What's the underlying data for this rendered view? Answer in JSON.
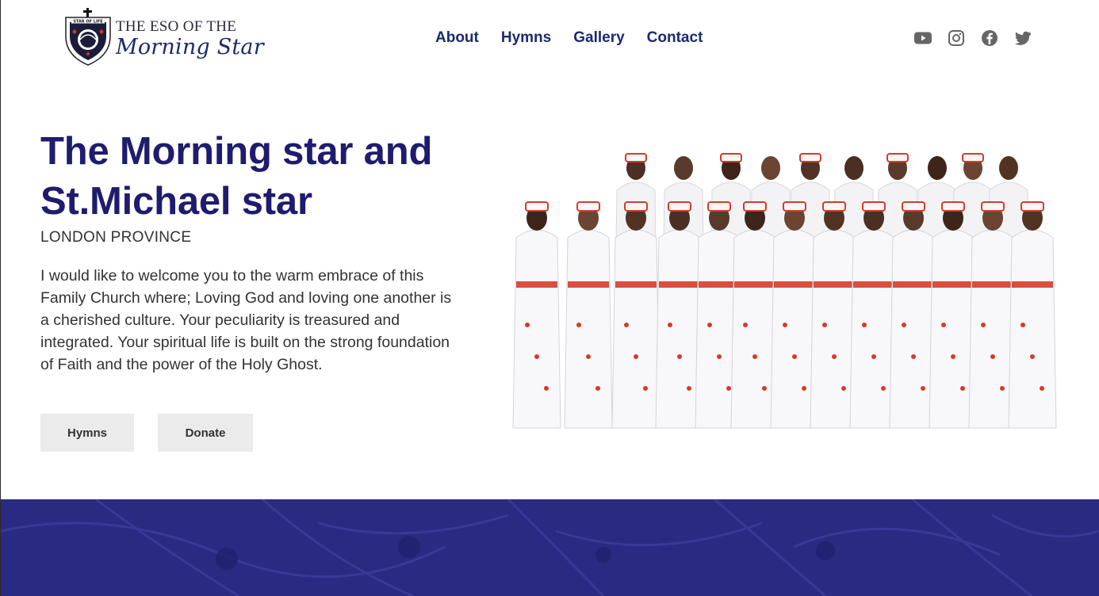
{
  "header": {
    "logo": {
      "badge_text": "STAR OF LIFE",
      "line1": "THE ESO OF THE",
      "line2": "Morning Star"
    },
    "nav": [
      {
        "label": "About"
      },
      {
        "label": "Hymns"
      },
      {
        "label": "Gallery"
      },
      {
        "label": "Contact"
      }
    ],
    "social_icons": [
      "youtube-icon",
      "instagram-icon",
      "facebook-icon",
      "twitter-icon"
    ]
  },
  "hero": {
    "title": "The Morning star and St.Michael star",
    "subtitle": "LONDON PROVINCE",
    "body": "I would like to welcome you to the warm embrace of this Family Church where; Loving God and loving one another is a cherished culture. Your peculiarity is treasured and integrated. Your spiritual life is built on the strong foundation of Faith and the power of the Holy Ghost.",
    "buttons": {
      "hymns": "Hymns",
      "donate": "Donate"
    }
  },
  "colors": {
    "brand_navy": "#1f1c6e",
    "nav_text": "#1c2a6e",
    "banner": "#2a2a82",
    "button_bg": "#ebebeb",
    "robe_red": "#d63a2a"
  }
}
